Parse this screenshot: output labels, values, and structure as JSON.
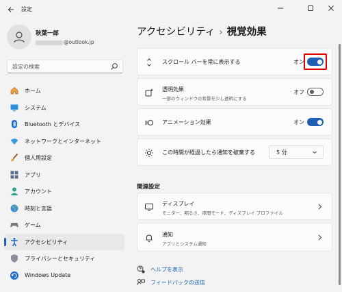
{
  "app": {
    "title": "設定"
  },
  "window_controls": {
    "minimize": "—",
    "maximize": "☐",
    "close": "✕"
  },
  "profile": {
    "name": "秋葉一郎",
    "email_visible": "@outlook.jp"
  },
  "search": {
    "placeholder": "設定の検索"
  },
  "nav": {
    "items": [
      {
        "label": "ホーム",
        "icon": "home-icon"
      },
      {
        "label": "システム",
        "icon": "system-icon"
      },
      {
        "label": "Bluetooth とデバイス",
        "icon": "bluetooth-icon"
      },
      {
        "label": "ネットワークとインターネット",
        "icon": "network-icon"
      },
      {
        "label": "個人用設定",
        "icon": "brush-icon"
      },
      {
        "label": "アプリ",
        "icon": "apps-icon"
      },
      {
        "label": "アカウント",
        "icon": "account-icon"
      },
      {
        "label": "時刻と言語",
        "icon": "globe-icon"
      },
      {
        "label": "ゲーム",
        "icon": "gamepad-icon"
      },
      {
        "label": "アクセシビリティ",
        "icon": "accessibility-icon",
        "active": true
      },
      {
        "label": "プライバシーとセキュリティ",
        "icon": "shield-icon"
      },
      {
        "label": "Windows Update",
        "icon": "update-icon"
      }
    ]
  },
  "breadcrumb": {
    "parent": "アクセシビリティ",
    "separator": "›",
    "current": "視覚効果"
  },
  "settings": {
    "scrollbars": {
      "title": "スクロール バーを常に表示する",
      "state": "オン",
      "on": true,
      "highlighted": true
    },
    "transparency": {
      "title": "透明効果",
      "subtitle": "一部のウィンドウの背景を少し透明にする",
      "state": "オフ",
      "on": false
    },
    "animation": {
      "title": "アニメーション効果",
      "state": "オン",
      "on": true
    },
    "notifications": {
      "title": "この時間が経過したら通知を破棄する",
      "value": "5 分"
    }
  },
  "related": {
    "title": "関連設定",
    "items": [
      {
        "title": "ディスプレイ",
        "subtitle": "モニター、明るさ、夜間モード、ディスプレイ プロファイル"
      },
      {
        "title": "通知",
        "subtitle": "アプリとシステム通知"
      }
    ]
  },
  "links": {
    "help": "ヘルプを表示",
    "feedback": "フィードバックの送信"
  },
  "colors": {
    "accent": "#1f5fb3",
    "highlight": "#e00000",
    "background": "#f3f3f3",
    "card": "#fbfbfb"
  }
}
